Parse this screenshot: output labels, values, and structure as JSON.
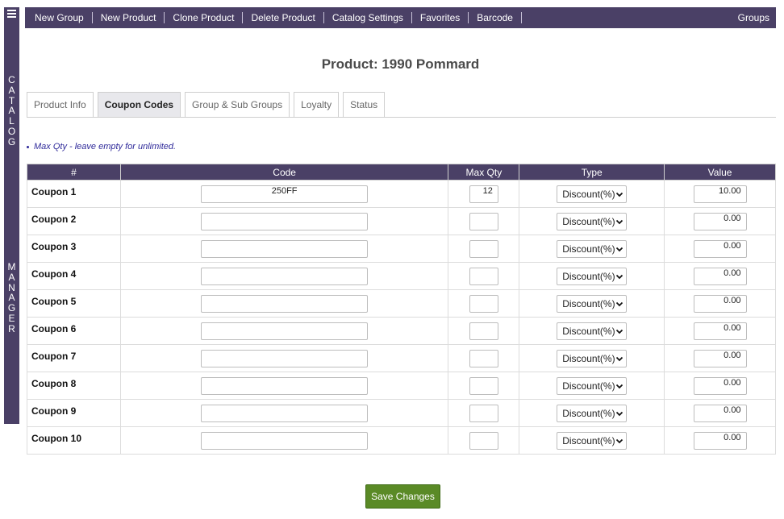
{
  "sidebar": {
    "menu_icon": "hamburger-menu-icon",
    "word_top": [
      "C",
      "A",
      "T",
      "A",
      "L",
      "O",
      "G"
    ],
    "word_bottom": [
      "M",
      "A",
      "N",
      "A",
      "G",
      "E",
      "R"
    ]
  },
  "topbar": {
    "items": [
      "New Group",
      "New Product",
      "Clone Product",
      "Delete Product",
      "Catalog Settings",
      "Favorites",
      "Barcode"
    ],
    "right_label": "Groups"
  },
  "page_title": "Product: 1990 Pommard",
  "tabs": [
    {
      "label": "Product Info",
      "active": false
    },
    {
      "label": "Coupon Codes",
      "active": true
    },
    {
      "label": "Group & Sub Groups",
      "active": false
    },
    {
      "label": "Loyalty",
      "active": false
    },
    {
      "label": "Status",
      "active": false
    }
  ],
  "note": "Max Qty - leave empty for unlimited.",
  "table": {
    "headers": [
      "#",
      "Code",
      "Max Qty",
      "Type",
      "Value"
    ],
    "rows": [
      {
        "label": "Coupon 1",
        "code": "250FF",
        "max_qty": "12",
        "type": "Discount(%)",
        "value": "10.00"
      },
      {
        "label": "Coupon 2",
        "code": "",
        "max_qty": "",
        "type": "Discount(%)",
        "value": "0.00"
      },
      {
        "label": "Coupon 3",
        "code": "",
        "max_qty": "",
        "type": "Discount(%)",
        "value": "0.00"
      },
      {
        "label": "Coupon 4",
        "code": "",
        "max_qty": "",
        "type": "Discount(%)",
        "value": "0.00"
      },
      {
        "label": "Coupon 5",
        "code": "",
        "max_qty": "",
        "type": "Discount(%)",
        "value": "0.00"
      },
      {
        "label": "Coupon 6",
        "code": "",
        "max_qty": "",
        "type": "Discount(%)",
        "value": "0.00"
      },
      {
        "label": "Coupon 7",
        "code": "",
        "max_qty": "",
        "type": "Discount(%)",
        "value": "0.00"
      },
      {
        "label": "Coupon 8",
        "code": "",
        "max_qty": "",
        "type": "Discount(%)",
        "value": "0.00"
      },
      {
        "label": "Coupon 9",
        "code": "",
        "max_qty": "",
        "type": "Discount(%)",
        "value": "0.00"
      },
      {
        "label": "Coupon 10",
        "code": "",
        "max_qty": "",
        "type": "Discount(%)",
        "value": "0.00"
      }
    ]
  },
  "save_label": "Save Changes",
  "colors": {
    "brand": "#4a4066",
    "save": "#5a8a26",
    "note": "#2f2a9a"
  }
}
